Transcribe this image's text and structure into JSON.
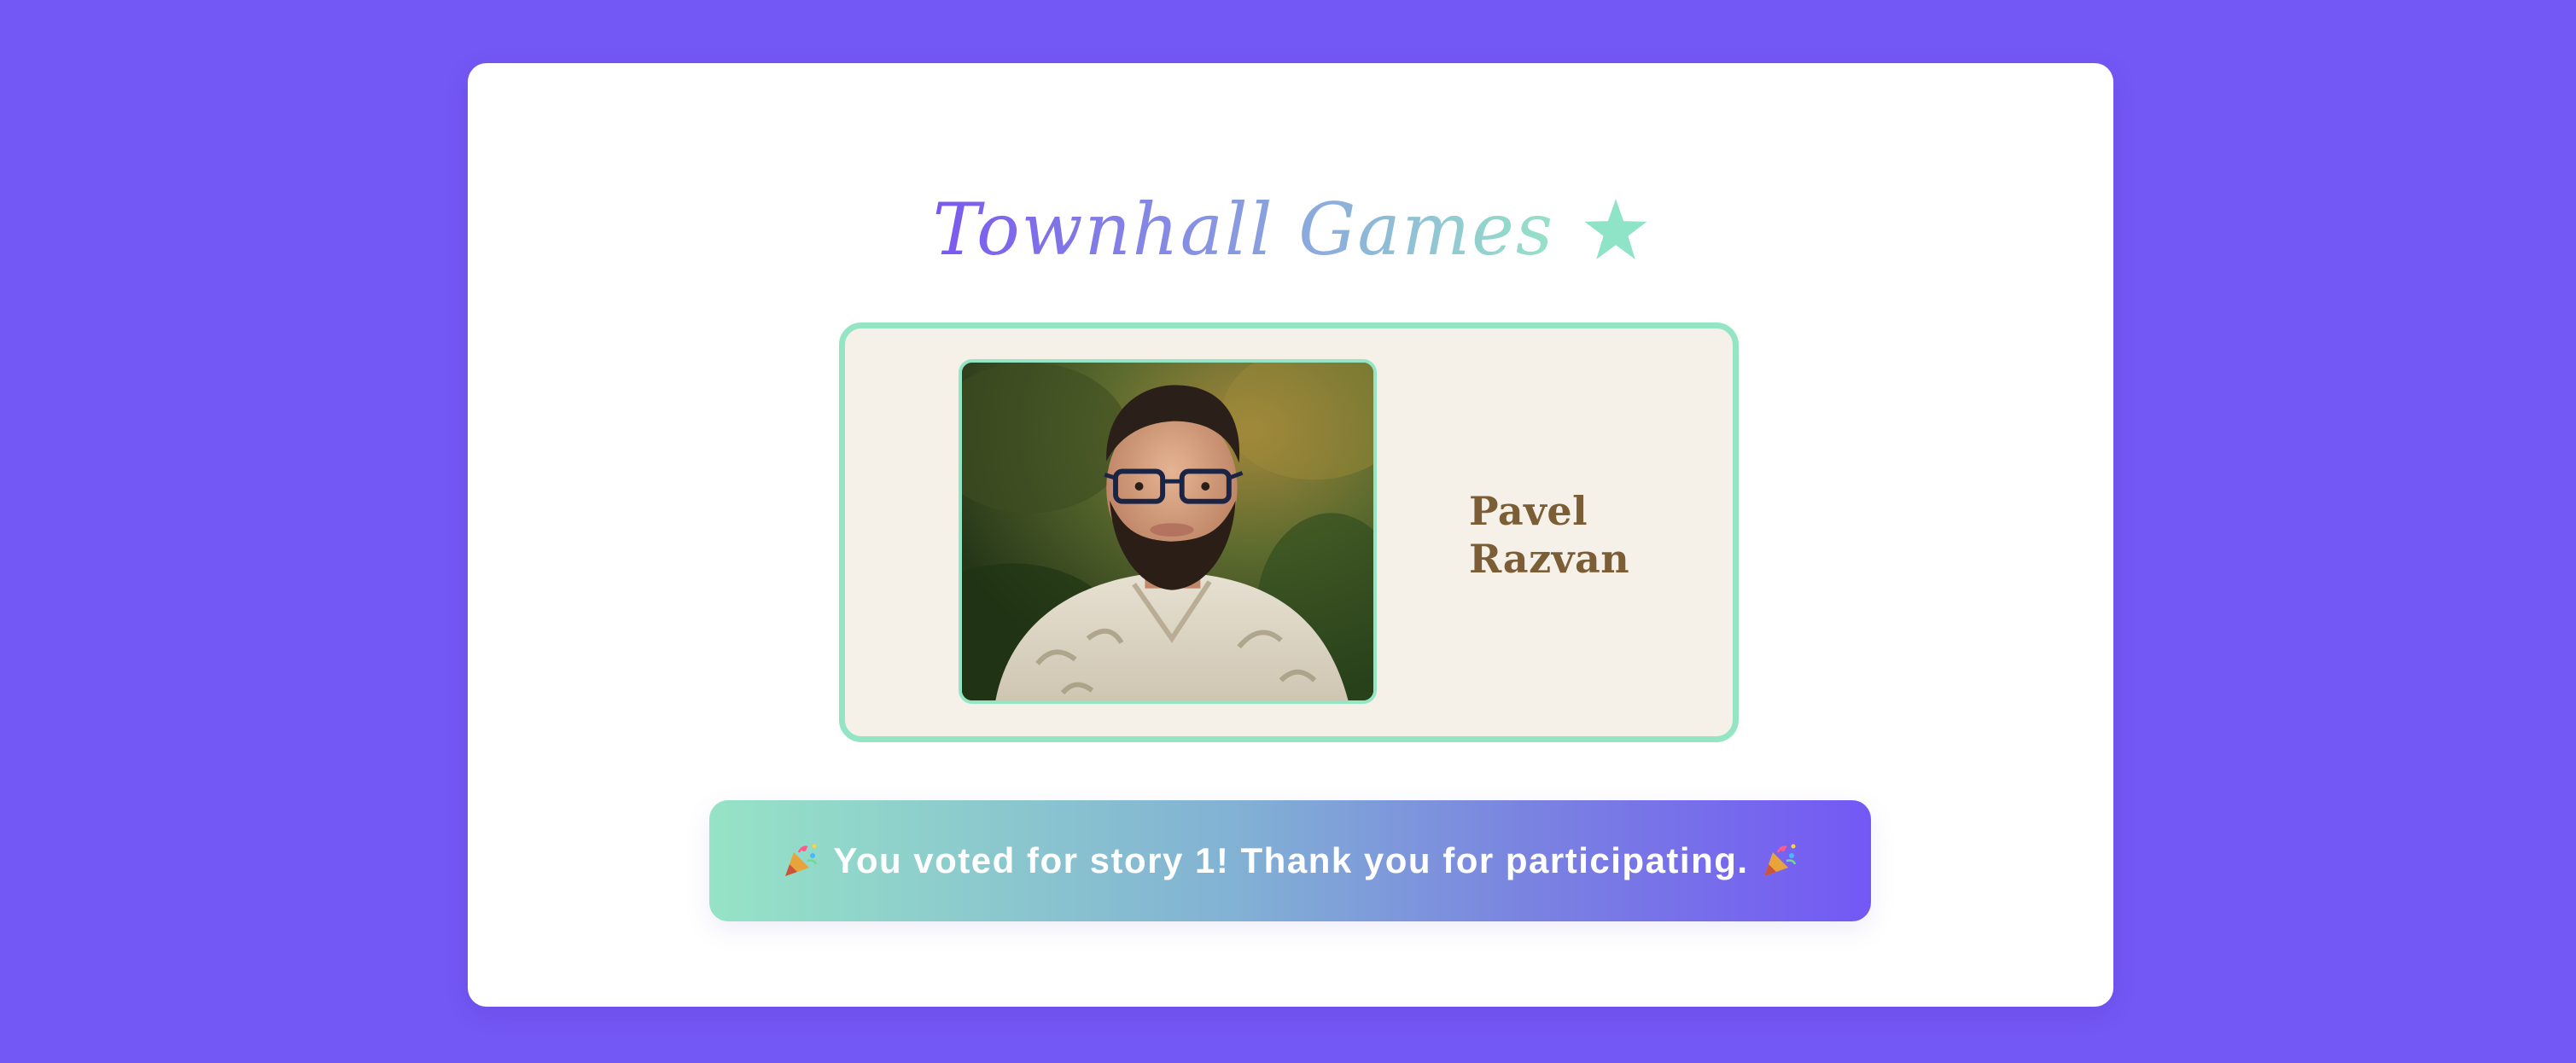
{
  "header": {
    "title": "Townhall Games",
    "title_icon": "star-icon",
    "title_gradient": [
      "#7a58ef",
      "#96e2c8"
    ]
  },
  "profile": {
    "first_name": "Pavel",
    "last_name": "Razvan",
    "photo": "portrait-photo"
  },
  "banner": {
    "message": "You voted for story 1! Thank you for participating.",
    "icon_left": "party-popper-icon",
    "icon_right": "party-popper-icon"
  },
  "colors": {
    "page_background": "#7458f5",
    "card_background": "#ffffff",
    "profile_card_background": "#f6f1e8",
    "profile_border": "#94e5c4",
    "name_text": "#7b5e36",
    "banner_gradient_start": "#96e3c6",
    "banner_gradient_end": "#7458f5"
  }
}
